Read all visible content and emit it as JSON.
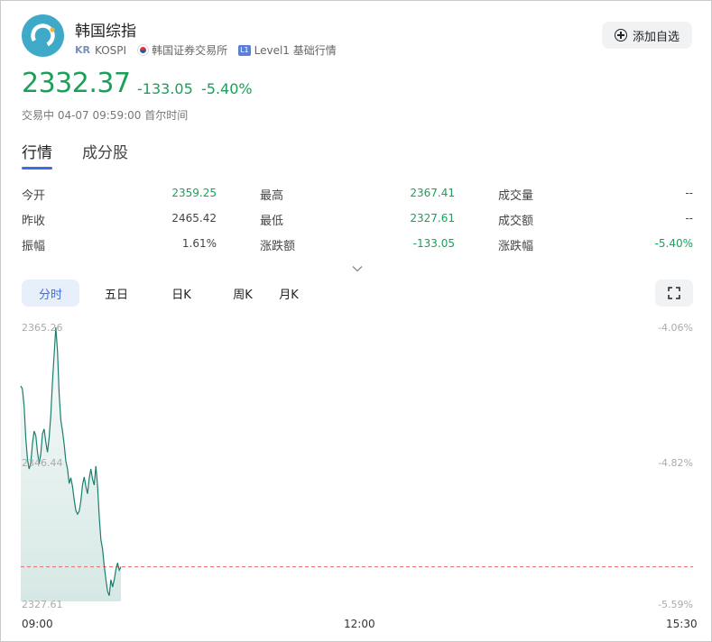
{
  "header": {
    "name": "韩国综指",
    "market_badge": "KR",
    "ticker": "KOSPI",
    "exchange": "韩国证券交易所",
    "level_badge": "L1",
    "level_text": "Level1 基础行情",
    "add_favorite_label": "添加自选"
  },
  "quote": {
    "price": "2332.37",
    "change": "-133.05",
    "change_pct": "-5.40%",
    "status": "交易中 04-07 09:59:00 首尔时间",
    "accent_color": "#1aa05a"
  },
  "tabs": [
    {
      "label": "行情",
      "active": true
    },
    {
      "label": "成分股",
      "active": false
    }
  ],
  "stats": {
    "open": {
      "label": "今开",
      "value": "2359.25"
    },
    "prev_close": {
      "label": "昨收",
      "value": "2465.42"
    },
    "amplitude": {
      "label": "振幅",
      "value": "1.61%"
    },
    "high": {
      "label": "最高",
      "value": "2367.41"
    },
    "low": {
      "label": "最低",
      "value": "2327.61"
    },
    "change": {
      "label": "涨跌额",
      "value": "-133.05"
    },
    "volume": {
      "label": "成交量",
      "value": "--"
    },
    "turnover": {
      "label": "成交额",
      "value": "--"
    },
    "change_pct": {
      "label": "涨跌幅",
      "value": "-5.40%"
    }
  },
  "period_tabs": [
    {
      "label": "分时",
      "active": true
    },
    {
      "label": "五日",
      "active": false
    },
    {
      "label": "日K",
      "active": false
    },
    {
      "label": "周K",
      "active": false
    },
    {
      "label": "月K",
      "active": false
    }
  ],
  "icons": {
    "expand": "chevron-down-icon",
    "fullscreen": "fullscreen-icon",
    "add": "plus-circle-icon",
    "logo": "kospi-logo-icon"
  },
  "chart_data": {
    "type": "area",
    "y_left_ticks": [
      "2365.26",
      "2346.44",
      "2327.61"
    ],
    "y_right_ticks": [
      "-4.06%",
      "-4.82%",
      "-5.59%"
    ],
    "x_ticks": [
      "09:00",
      "12:00",
      "15:30"
    ],
    "ylim": [
      2327.61,
      2365.26
    ],
    "reference_line": 2332.37,
    "series": [
      {
        "color": "#1a7f6e",
        "values": [
          2357.2,
          2356.8,
          2354.5,
          2350.1,
          2347.2,
          2345.8,
          2346.6,
          2349.3,
          2351.0,
          2350.4,
          2348.2,
          2346.5,
          2347.9,
          2350.6,
          2351.3,
          2349.5,
          2348.1,
          2350.1,
          2353.2,
          2357.8,
          2361.5,
          2365.26,
          2362.0,
          2356.1,
          2352.5,
          2351.0,
          2349.2,
          2346.9,
          2345.8,
          2343.8,
          2344.6,
          2343.4,
          2341.6,
          2340.1,
          2339.6,
          2340.0,
          2341.4,
          2343.6,
          2344.7,
          2343.4,
          2342.4,
          2344.5,
          2345.8,
          2344.4,
          2343.6,
          2346.2,
          2343.5,
          2339.3,
          2336.1,
          2334.8,
          2332.5,
          2330.6,
          2329.0,
          2328.4,
          2330.6,
          2329.6,
          2330.6,
          2332.0,
          2332.9,
          2331.9,
          2332.37
        ]
      }
    ]
  }
}
